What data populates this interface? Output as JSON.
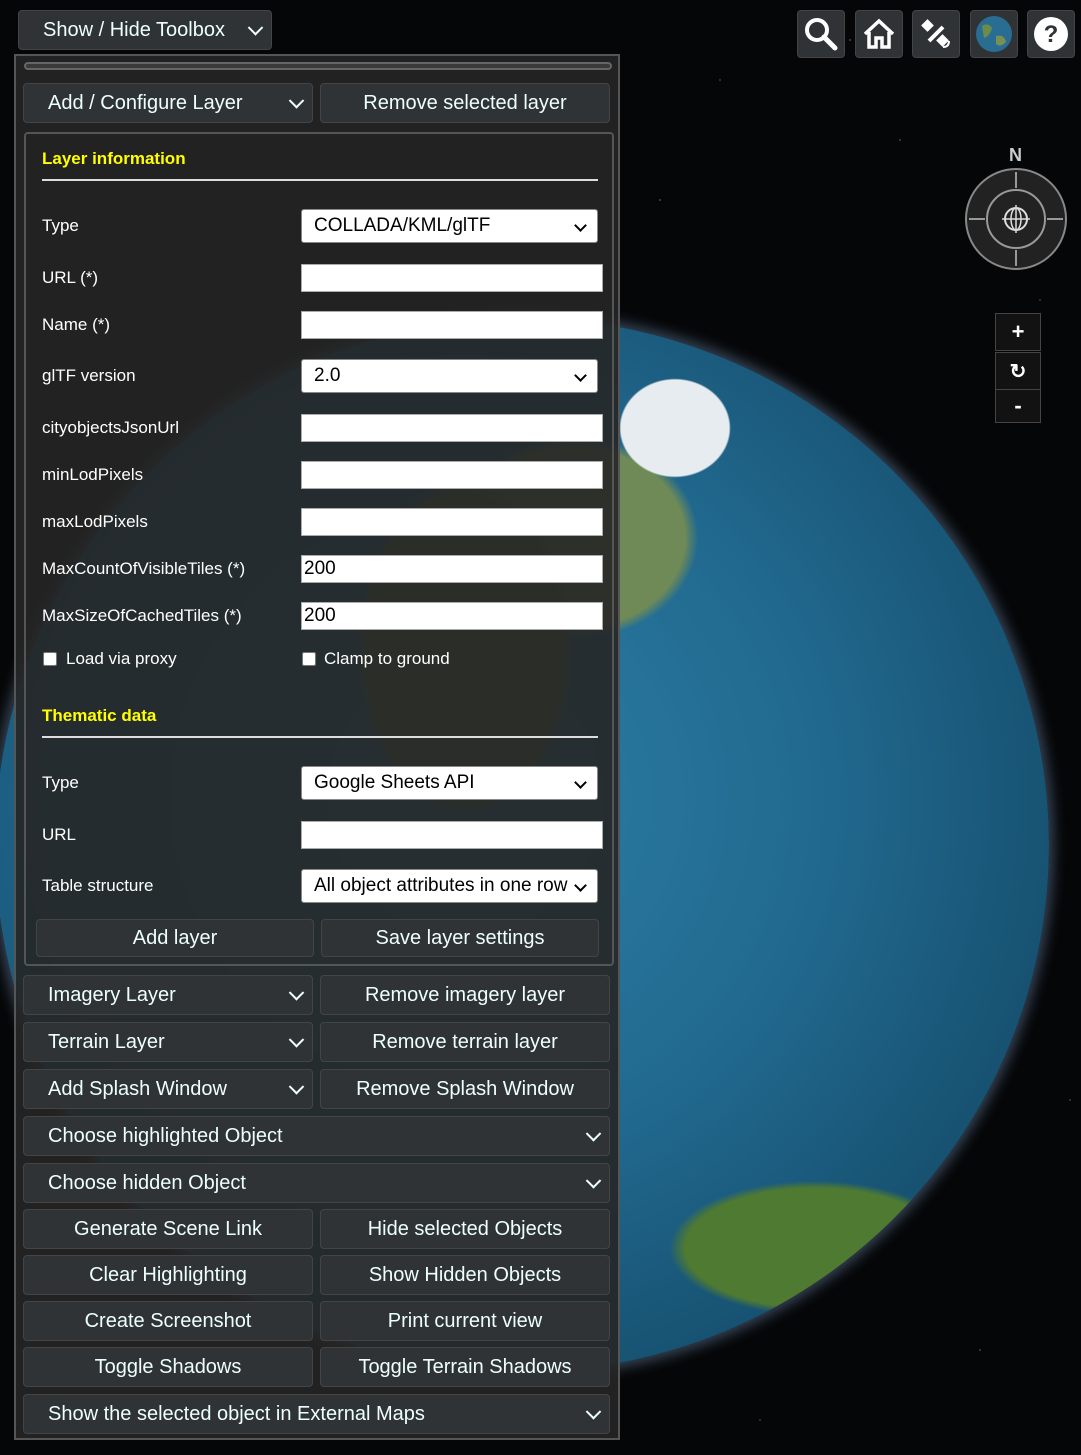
{
  "toolbox_toggle": {
    "label": "Show / Hide Toolbox"
  },
  "layer_buttons": {
    "add_configure": "Add / Configure Layer",
    "remove_selected": "Remove selected layer"
  },
  "layer_info": {
    "title": "Layer information",
    "type_label": "Type",
    "type_value": "COLLADA/KML/glTF",
    "url_label": "URL (*)",
    "url_value": "",
    "name_label": "Name (*)",
    "name_value": "",
    "gltf_label": "glTF version",
    "gltf_value": "2.0",
    "cityobjects_label": "cityobjectsJsonUrl",
    "cityobjects_value": "",
    "minlod_label": "minLodPixels",
    "minlod_value": "",
    "maxlod_label": "maxLodPixels",
    "maxlod_value": "",
    "maxcount_label": "MaxCountOfVisibleTiles (*)",
    "maxcount_value": "200",
    "maxsize_label": "MaxSizeOfCachedTiles (*)",
    "maxsize_value": "200",
    "load_proxy_label": "Load via proxy",
    "clamp_label": "Clamp to ground"
  },
  "thematic": {
    "title": "Thematic data",
    "type_label": "Type",
    "type_value": "Google Sheets API",
    "url_label": "URL",
    "url_value": "",
    "structure_label": "Table structure",
    "structure_value": "All object attributes in one row"
  },
  "panel_actions": {
    "add_layer": "Add layer",
    "save_settings": "Save layer settings"
  },
  "tools": {
    "imagery_layer": "Imagery Layer",
    "remove_imagery": "Remove imagery layer",
    "terrain_layer": "Terrain Layer",
    "remove_terrain": "Remove terrain layer",
    "add_splash": "Add Splash Window",
    "remove_splash": "Remove Splash Window",
    "highlighted": "Choose highlighted Object",
    "hidden": "Choose hidden Object",
    "scene_link": "Generate Scene Link",
    "hide_selected": "Hide selected Objects",
    "clear_highlight": "Clear Highlighting",
    "show_hidden": "Show Hidden Objects",
    "screenshot": "Create Screenshot",
    "print": "Print current view",
    "shadows": "Toggle Shadows",
    "terrain_shadows": "Toggle Terrain Shadows",
    "external_maps": "Show the selected object in External Maps"
  },
  "compass": {
    "north": "N"
  },
  "zoom": {
    "in": "+",
    "reset": "↻",
    "out": "-"
  },
  "icons": [
    "search-icon",
    "home-icon",
    "satellite-icon",
    "globe-icon",
    "help-icon"
  ]
}
